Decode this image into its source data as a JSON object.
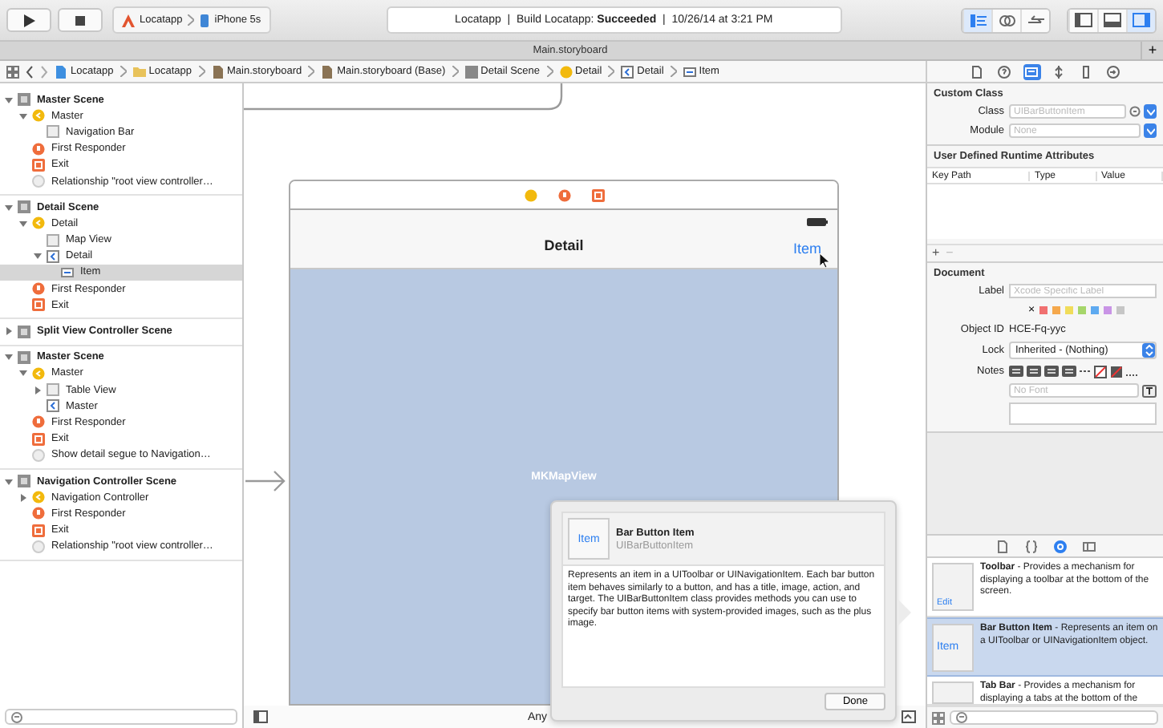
{
  "toolbar": {
    "scheme": {
      "project": "Locatapp",
      "device": "iPhone 5s"
    },
    "status": "Locatapp  |  Build Locatapp: **Succeeded**  |  10/26/14 at 3:21 PM",
    "editor_modes": [
      {
        "kind": "standard",
        "selected": true
      },
      {
        "kind": "assistant",
        "selected": false
      },
      {
        "kind": "version",
        "selected": false
      }
    ],
    "panels": [
      {
        "kind": "navigator",
        "selected": false
      },
      {
        "kind": "debug",
        "selected": false
      },
      {
        "kind": "utilities",
        "selected": true
      }
    ]
  },
  "tab": {
    "title": "Main.storyboard",
    "add": "+"
  },
  "jump_bar": {
    "crumbs": [
      {
        "label": "Locatapp",
        "kind": "project"
      },
      {
        "label": "Locatapp",
        "kind": "folder"
      },
      {
        "label": "Main.storyboard",
        "kind": "storyboard"
      },
      {
        "label": "Main.storyboard (Base)",
        "kind": "storyboard"
      },
      {
        "label": "Detail Scene",
        "kind": "scene"
      },
      {
        "label": "Detail",
        "kind": "controller"
      },
      {
        "label": "Detail",
        "kind": "navitem"
      },
      {
        "label": "Item",
        "kind": "baritem"
      }
    ]
  },
  "outline": {
    "scenes": [
      {
        "label": "Master Scene",
        "kind": "scene",
        "expanded": true,
        "selected": false,
        "children": [
          {
            "label": "Master",
            "kind": "controller",
            "expanded": true,
            "selected": false,
            "children": [
              {
                "label": "Navigation Bar",
                "kind": "view",
                "selected": false
              }
            ]
          },
          {
            "label": "First Responder",
            "kind": "responder",
            "selected": false
          },
          {
            "label": "Exit",
            "kind": "exit",
            "selected": false
          },
          {
            "label": "Relationship \"root view controller…",
            "kind": "segue",
            "selected": false
          }
        ]
      },
      {
        "label": "Detail Scene",
        "kind": "scene",
        "expanded": true,
        "selected": false,
        "children": [
          {
            "label": "Detail",
            "kind": "controller",
            "expanded": true,
            "selected": false,
            "children": [
              {
                "label": "Map View",
                "kind": "view",
                "selected": false
              },
              {
                "label": "Detail",
                "kind": "navitem",
                "expanded": true,
                "selected": false,
                "children": [
                  {
                    "label": "Item",
                    "kind": "baritem",
                    "selected": true
                  }
                ]
              }
            ]
          },
          {
            "label": "First Responder",
            "kind": "responder",
            "selected": false
          },
          {
            "label": "Exit",
            "kind": "exit",
            "selected": false
          }
        ]
      },
      {
        "label": "Split View Controller Scene",
        "kind": "scene",
        "expanded": false,
        "selected": false
      },
      {
        "label": "Master Scene",
        "kind": "scene",
        "expanded": true,
        "selected": false,
        "children": [
          {
            "label": "Master",
            "kind": "controller",
            "expanded": true,
            "selected": false,
            "children": [
              {
                "label": "Table View",
                "kind": "view",
                "expanded": false,
                "selected": false
              },
              {
                "label": "Master",
                "kind": "navitem",
                "selected": false
              }
            ]
          },
          {
            "label": "First Responder",
            "kind": "responder",
            "selected": false
          },
          {
            "label": "Exit",
            "kind": "exit",
            "selected": false
          },
          {
            "label": "Show detail segue to Navigation…",
            "kind": "segue",
            "selected": false
          }
        ]
      },
      {
        "label": "Navigation Controller Scene",
        "kind": "scene",
        "expanded": true,
        "selected": false,
        "children": [
          {
            "label": "Navigation Controller",
            "kind": "controller",
            "expanded": false,
            "selected": false
          },
          {
            "label": "First Responder",
            "kind": "responder",
            "selected": false
          },
          {
            "label": "Exit",
            "kind": "exit",
            "selected": false
          },
          {
            "label": "Relationship \"root view controller…",
            "kind": "segue",
            "selected": false
          }
        ]
      }
    ]
  },
  "canvas": {
    "nav_title": "Detail",
    "bar_item": "Item",
    "view_label": "MKMapView",
    "size_class": "Any"
  },
  "popover": {
    "thumb": "Item",
    "title": "Bar Button Item",
    "class_name": "UIBarButtonItem",
    "description": "Represents an item in a UIToolbar or UINavigationItem. Each bar button item behaves similarly to a button, and has a title, image, action, and target. The UIBarButtonItem class provides methods you can use to specify bar button items with system-provided images, such as the plus image.",
    "button": "Done"
  },
  "inspector": {
    "tabs": [
      {
        "kind": "file",
        "selected": false
      },
      {
        "kind": "help",
        "selected": false
      },
      {
        "kind": "identity",
        "selected": true
      },
      {
        "kind": "attributes",
        "selected": false
      },
      {
        "kind": "size",
        "selected": false
      },
      {
        "kind": "connections",
        "selected": false
      }
    ],
    "custom_class": {
      "title": "Custom Class",
      "class": {
        "label": "Class",
        "placeholder": "UIBarButtonItem"
      },
      "module": {
        "label": "Module",
        "placeholder": "None"
      }
    },
    "runtime_attributes": {
      "title": "User Defined Runtime Attributes",
      "columns": [
        "Key Path",
        "Type",
        "Value"
      ],
      "add": "+",
      "remove": "−"
    },
    "document": {
      "title": "Document",
      "label": {
        "label": "Label",
        "placeholder": "Xcode Specific Label"
      },
      "clear": "×",
      "colors": [
        {
          "color": "#f07070"
        },
        {
          "color": "#f5a84c"
        },
        {
          "color": "#f0dc5a"
        },
        {
          "color": "#a6d66a"
        },
        {
          "color": "#5eaaf0"
        },
        {
          "color": "#c994e6"
        },
        {
          "color": "#c6c6c6"
        }
      ],
      "object_id": {
        "label": "Object ID",
        "value": "HCE-Fq-yyc"
      },
      "lock": {
        "label": "Lock",
        "value": "Inherited - (Nothing)"
      },
      "notes": {
        "label": "Notes",
        "font_placeholder": "No Font"
      }
    }
  },
  "library": {
    "tabs": [
      {
        "kind": "file",
        "selected": false
      },
      {
        "kind": "code",
        "selected": false
      },
      {
        "kind": "object",
        "selected": true
      },
      {
        "kind": "media",
        "selected": false
      }
    ],
    "items": [
      {
        "thumb": "Edit",
        "text": "**Toolbar** - Provides a mechanism for displaying a toolbar at the bottom of the screen.",
        "selected": false
      },
      {
        "thumb": "Item",
        "text": "**Bar Button Item** - Represents an item on a UIToolbar or UINavigationItem object.",
        "selected": true
      },
      {
        "text": "**Tab Bar** - Provides a mechanism for displaying a tabs at the bottom of the",
        "selected": false
      }
    ]
  }
}
